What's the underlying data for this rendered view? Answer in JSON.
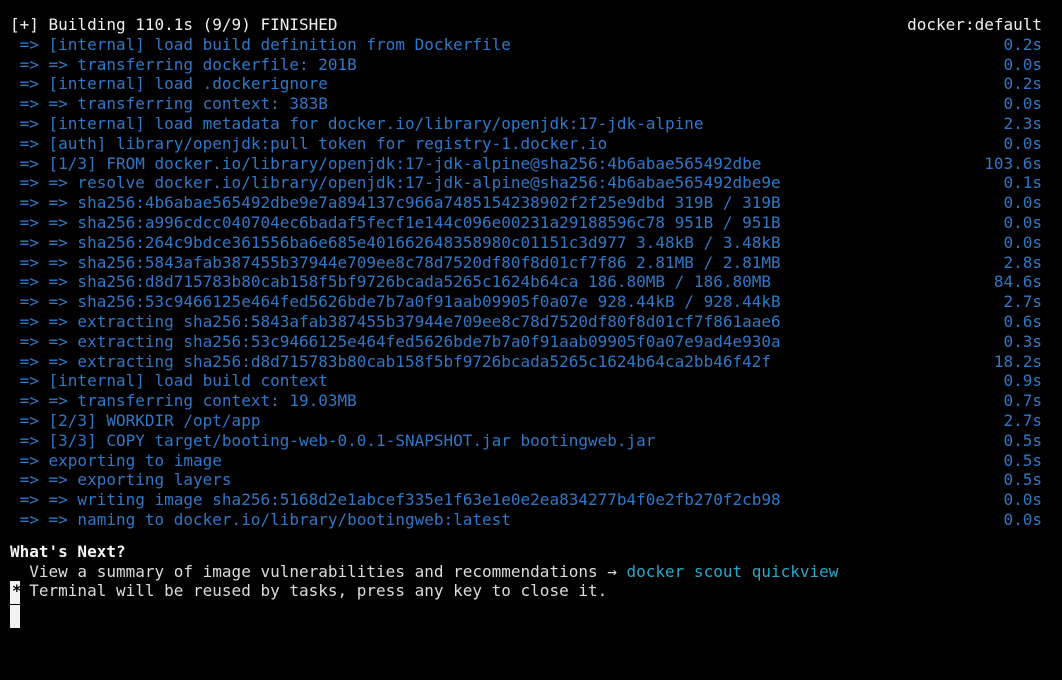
{
  "header": {
    "status": "[+] Building 110.1s (9/9) FINISHED",
    "context": "docker:default"
  },
  "steps": [
    {
      "text": " => [internal] load build definition from Dockerfile",
      "time": "0.2s"
    },
    {
      "text": " => => transferring dockerfile: 201B",
      "time": "0.0s"
    },
    {
      "text": " => [internal] load .dockerignore",
      "time": "0.2s"
    },
    {
      "text": " => => transferring context: 383B",
      "time": "0.0s"
    },
    {
      "text": " => [internal] load metadata for docker.io/library/openjdk:17-jdk-alpine",
      "time": "2.3s"
    },
    {
      "text": " => [auth] library/openjdk:pull token for registry-1.docker.io",
      "time": "0.0s"
    },
    {
      "text": " => [1/3] FROM docker.io/library/openjdk:17-jdk-alpine@sha256:4b6abae565492dbe",
      "time": "103.6s"
    },
    {
      "text": " => => resolve docker.io/library/openjdk:17-jdk-alpine@sha256:4b6abae565492dbe9e",
      "time": "0.1s"
    },
    {
      "text": " => => sha256:4b6abae565492dbe9e7a894137c966a7485154238902f2f25e9dbd 319B / 319B",
      "time": "0.0s"
    },
    {
      "text": " => => sha256:a996cdcc040704ec6badaf5fecf1e144c096e00231a29188596c78 951B / 951B",
      "time": "0.0s"
    },
    {
      "text": " => => sha256:264c9bdce361556ba6e685e401662648358980c01151c3d977 3.48kB / 3.48kB",
      "time": "0.0s"
    },
    {
      "text": " => => sha256:5843afab387455b37944e709ee8c78d7520df80f8d01cf7f86 2.81MB / 2.81MB",
      "time": "2.8s"
    },
    {
      "text": " => => sha256:d8d715783b80cab158f5bf9726bcada5265c1624b64ca 186.80MB / 186.80MB",
      "time": "84.6s"
    },
    {
      "text": " => => sha256:53c9466125e464fed5626bde7b7a0f91aab09905f0a07e 928.44kB / 928.44kB",
      "time": "2.7s"
    },
    {
      "text": " => => extracting sha256:5843afab387455b37944e709ee8c78d7520df80f8d01cf7f861aae6",
      "time": "0.6s"
    },
    {
      "text": " => => extracting sha256:53c9466125e464fed5626bde7b7a0f91aab09905f0a07e9ad4e930a",
      "time": "0.3s"
    },
    {
      "text": " => => extracting sha256:d8d715783b80cab158f5bf9726bcada5265c1624b64ca2bb46f42f",
      "time": "18.2s"
    },
    {
      "text": " => [internal] load build context",
      "time": "0.9s"
    },
    {
      "text": " => => transferring context: 19.03MB",
      "time": "0.7s"
    },
    {
      "text": " => [2/3] WORKDIR /opt/app",
      "time": "2.7s"
    },
    {
      "text": " => [3/3] COPY target/booting-web-0.0.1-SNAPSHOT.jar bootingweb.jar",
      "time": "0.5s"
    },
    {
      "text": " => exporting to image",
      "time": "0.5s"
    },
    {
      "text": " => => exporting layers",
      "time": "0.5s"
    },
    {
      "text": " => => writing image sha256:5168d2e1abcef335e1f63e1e0e2ea834277b4f0e2fb270f2cb98",
      "time": "0.0s"
    },
    {
      "text": " => => naming to docker.io/library/bootingweb:latest",
      "time": "0.0s"
    }
  ],
  "next": {
    "title": "What's Next?",
    "summary": "  View a summary of image vulnerabilities and recommendations → ",
    "command": "docker scout quickview"
  },
  "notice": {
    "marker": "*",
    "text": "  Terminal will be reused by tasks, press any key to close it."
  },
  "colors": {
    "background": "#000000",
    "step": "#2f78c8",
    "link": "#2aa7c7",
    "text": "#dcdcdc"
  }
}
